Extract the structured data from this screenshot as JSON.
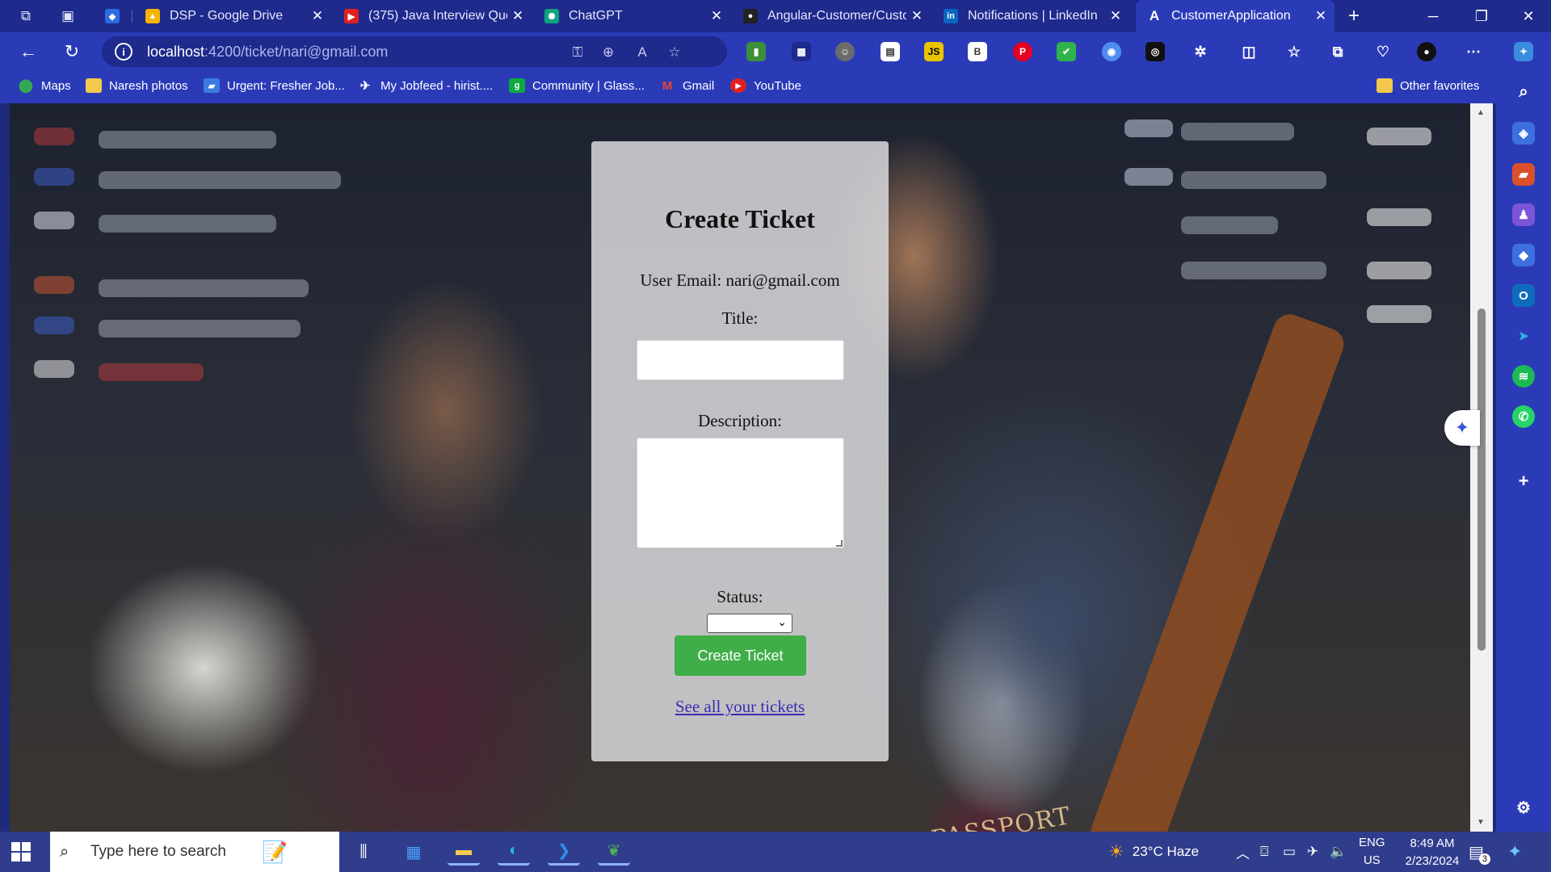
{
  "browser": {
    "tabs": [
      {
        "label": "",
        "favicon": "shield-icon",
        "color": "#2b6de0",
        "active": false
      },
      {
        "label": "DSP - Google Drive",
        "favicon": "drive-icon",
        "color": "#f4b400",
        "active": false
      },
      {
        "label": "(375) Java Interview Ques",
        "favicon": "youtube-icon",
        "color": "#e02020",
        "active": false
      },
      {
        "label": "ChatGPT",
        "favicon": "chatgpt-icon",
        "color": "#10a37f",
        "active": false
      },
      {
        "label": "Angular-Customer/Custo",
        "favicon": "github-icon",
        "color": "#222222",
        "active": false
      },
      {
        "label": "Notifications | LinkedIn",
        "favicon": "linkedin-icon",
        "color": "#0a66c2",
        "active": false
      },
      {
        "label": "CustomerApplication",
        "favicon": "angular-icon",
        "color": "#ffffff",
        "active": true
      }
    ],
    "address": {
      "host": "localhost",
      "path": ":4200/ticket/nari@gmail.com"
    },
    "bookmarks": [
      {
        "label": "Maps",
        "icon": "maps-icon",
        "color": "#34a853"
      },
      {
        "label": "Naresh photos",
        "icon": "folder-icon",
        "color": "#f2c94c"
      },
      {
        "label": "Urgent: Fresher Job...",
        "icon": "job-icon",
        "color": "#3d7be0"
      },
      {
        "label": "My Jobfeed - hirist....",
        "icon": "hirist-icon",
        "color": "#555555"
      },
      {
        "label": "Community | Glass...",
        "icon": "glassdoor-icon",
        "color": "#0caa41"
      },
      {
        "label": "Gmail",
        "icon": "gmail-icon",
        "color": "#ea4335"
      },
      {
        "label": "YouTube",
        "icon": "youtube-icon",
        "color": "#e02020"
      }
    ],
    "other_favorites": "Other favorites"
  },
  "form": {
    "heading": "Create Ticket",
    "user_email_label": "User Email: nari@gmail.com",
    "title_label": "Title:",
    "title_value": "",
    "description_label": "Description:",
    "description_value": "",
    "status_label": "Status:",
    "status_value": "",
    "submit_label": "Create Ticket",
    "all_tickets_link": "See all your tickets"
  },
  "background": {
    "passport_text": "PASSPORT"
  },
  "taskbar": {
    "search_placeholder": "Type here to search",
    "weather": "23°C  Haze",
    "lang_top": "ENG",
    "lang_bottom": "US",
    "time": "8:49 AM",
    "date": "2/23/2024",
    "notifications": "3"
  }
}
